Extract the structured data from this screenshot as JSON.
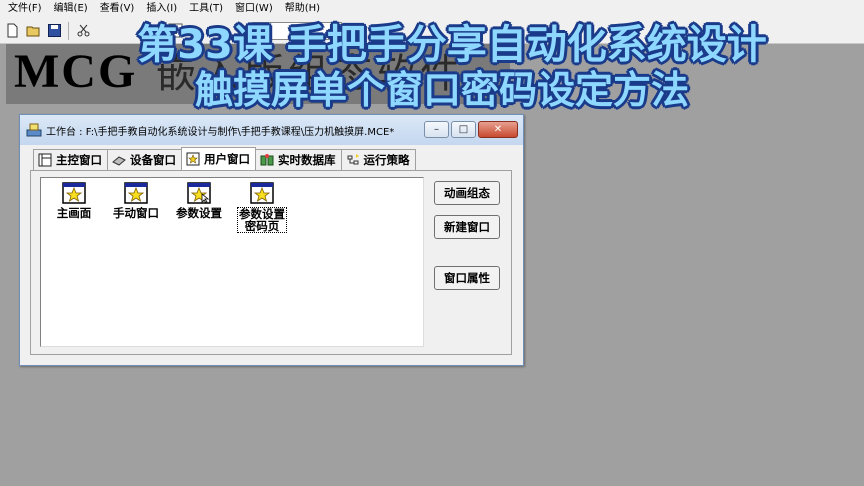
{
  "menu": [
    "文件(F)",
    "编辑(E)",
    "查看(V)",
    "插入(I)",
    "工具(T)",
    "窗口(W)",
    "帮助(H)"
  ],
  "banner": {
    "logo": "MCG",
    "deco": "嵌入版组态软件"
  },
  "overlay": {
    "line1": "第33课 手把手分享自动化系统设计",
    "line2": "触摸屏单个窗口密码设定方法"
  },
  "window": {
    "title": "工作台 : F:\\手把手教自动化系统设计与制作\\手把手教课程\\压力机触摸屏.MCE*",
    "controls": {
      "minimize": "–",
      "restore": "□",
      "close": "✕"
    }
  },
  "tabs": [
    {
      "label": "主控窗口",
      "icon": "main-window-icon"
    },
    {
      "label": "设备窗口",
      "icon": "device-window-icon"
    },
    {
      "label": "用户窗口",
      "icon": "user-window-icon",
      "active": true
    },
    {
      "label": "实时数据库",
      "icon": "realtime-db-icon"
    },
    {
      "label": "运行策略",
      "icon": "run-strategy-icon"
    }
  ],
  "windows": [
    {
      "label": "主画面"
    },
    {
      "label": "手动窗口"
    },
    {
      "label": "参数设置"
    },
    {
      "label1": "参数设置",
      "label2": "密码页",
      "selected": true
    }
  ],
  "buttons": {
    "animate": "动画组态",
    "new_window": "新建窗口",
    "properties": "窗口属性"
  },
  "colors": {
    "overlay_fill": "#8ed8ff",
    "overlay_outline": "#1a3a8a",
    "desktop": "#a0a0a0"
  }
}
